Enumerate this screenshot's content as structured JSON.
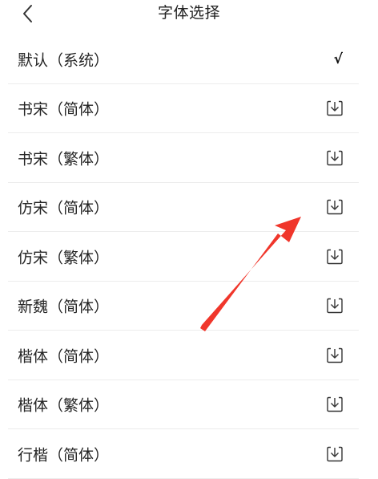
{
  "header": {
    "title": "字体选择",
    "back_icon": "chevron-left-icon"
  },
  "fonts": [
    {
      "label": "默认（系统）",
      "status": "selected",
      "check_glyph": "√",
      "icon": "check-icon"
    },
    {
      "label": "书宋（简体）",
      "status": "download",
      "icon": "download-icon"
    },
    {
      "label": "书宋（繁体）",
      "status": "download",
      "icon": "download-icon"
    },
    {
      "label": "仿宋（简体）",
      "status": "download",
      "icon": "download-icon"
    },
    {
      "label": "仿宋（繁体）",
      "status": "download",
      "icon": "download-icon"
    },
    {
      "label": "新魏（简体）",
      "status": "download",
      "icon": "download-icon"
    },
    {
      "label": "楷体（简体）",
      "status": "download",
      "icon": "download-icon"
    },
    {
      "label": "楷体（繁体）",
      "status": "download",
      "icon": "download-icon"
    },
    {
      "label": "行楷（简体）",
      "status": "download",
      "icon": "download-icon"
    }
  ],
  "annotation": {
    "arrow_color": "#f0362b",
    "arrow_icon": "red-arrow-annotation"
  }
}
